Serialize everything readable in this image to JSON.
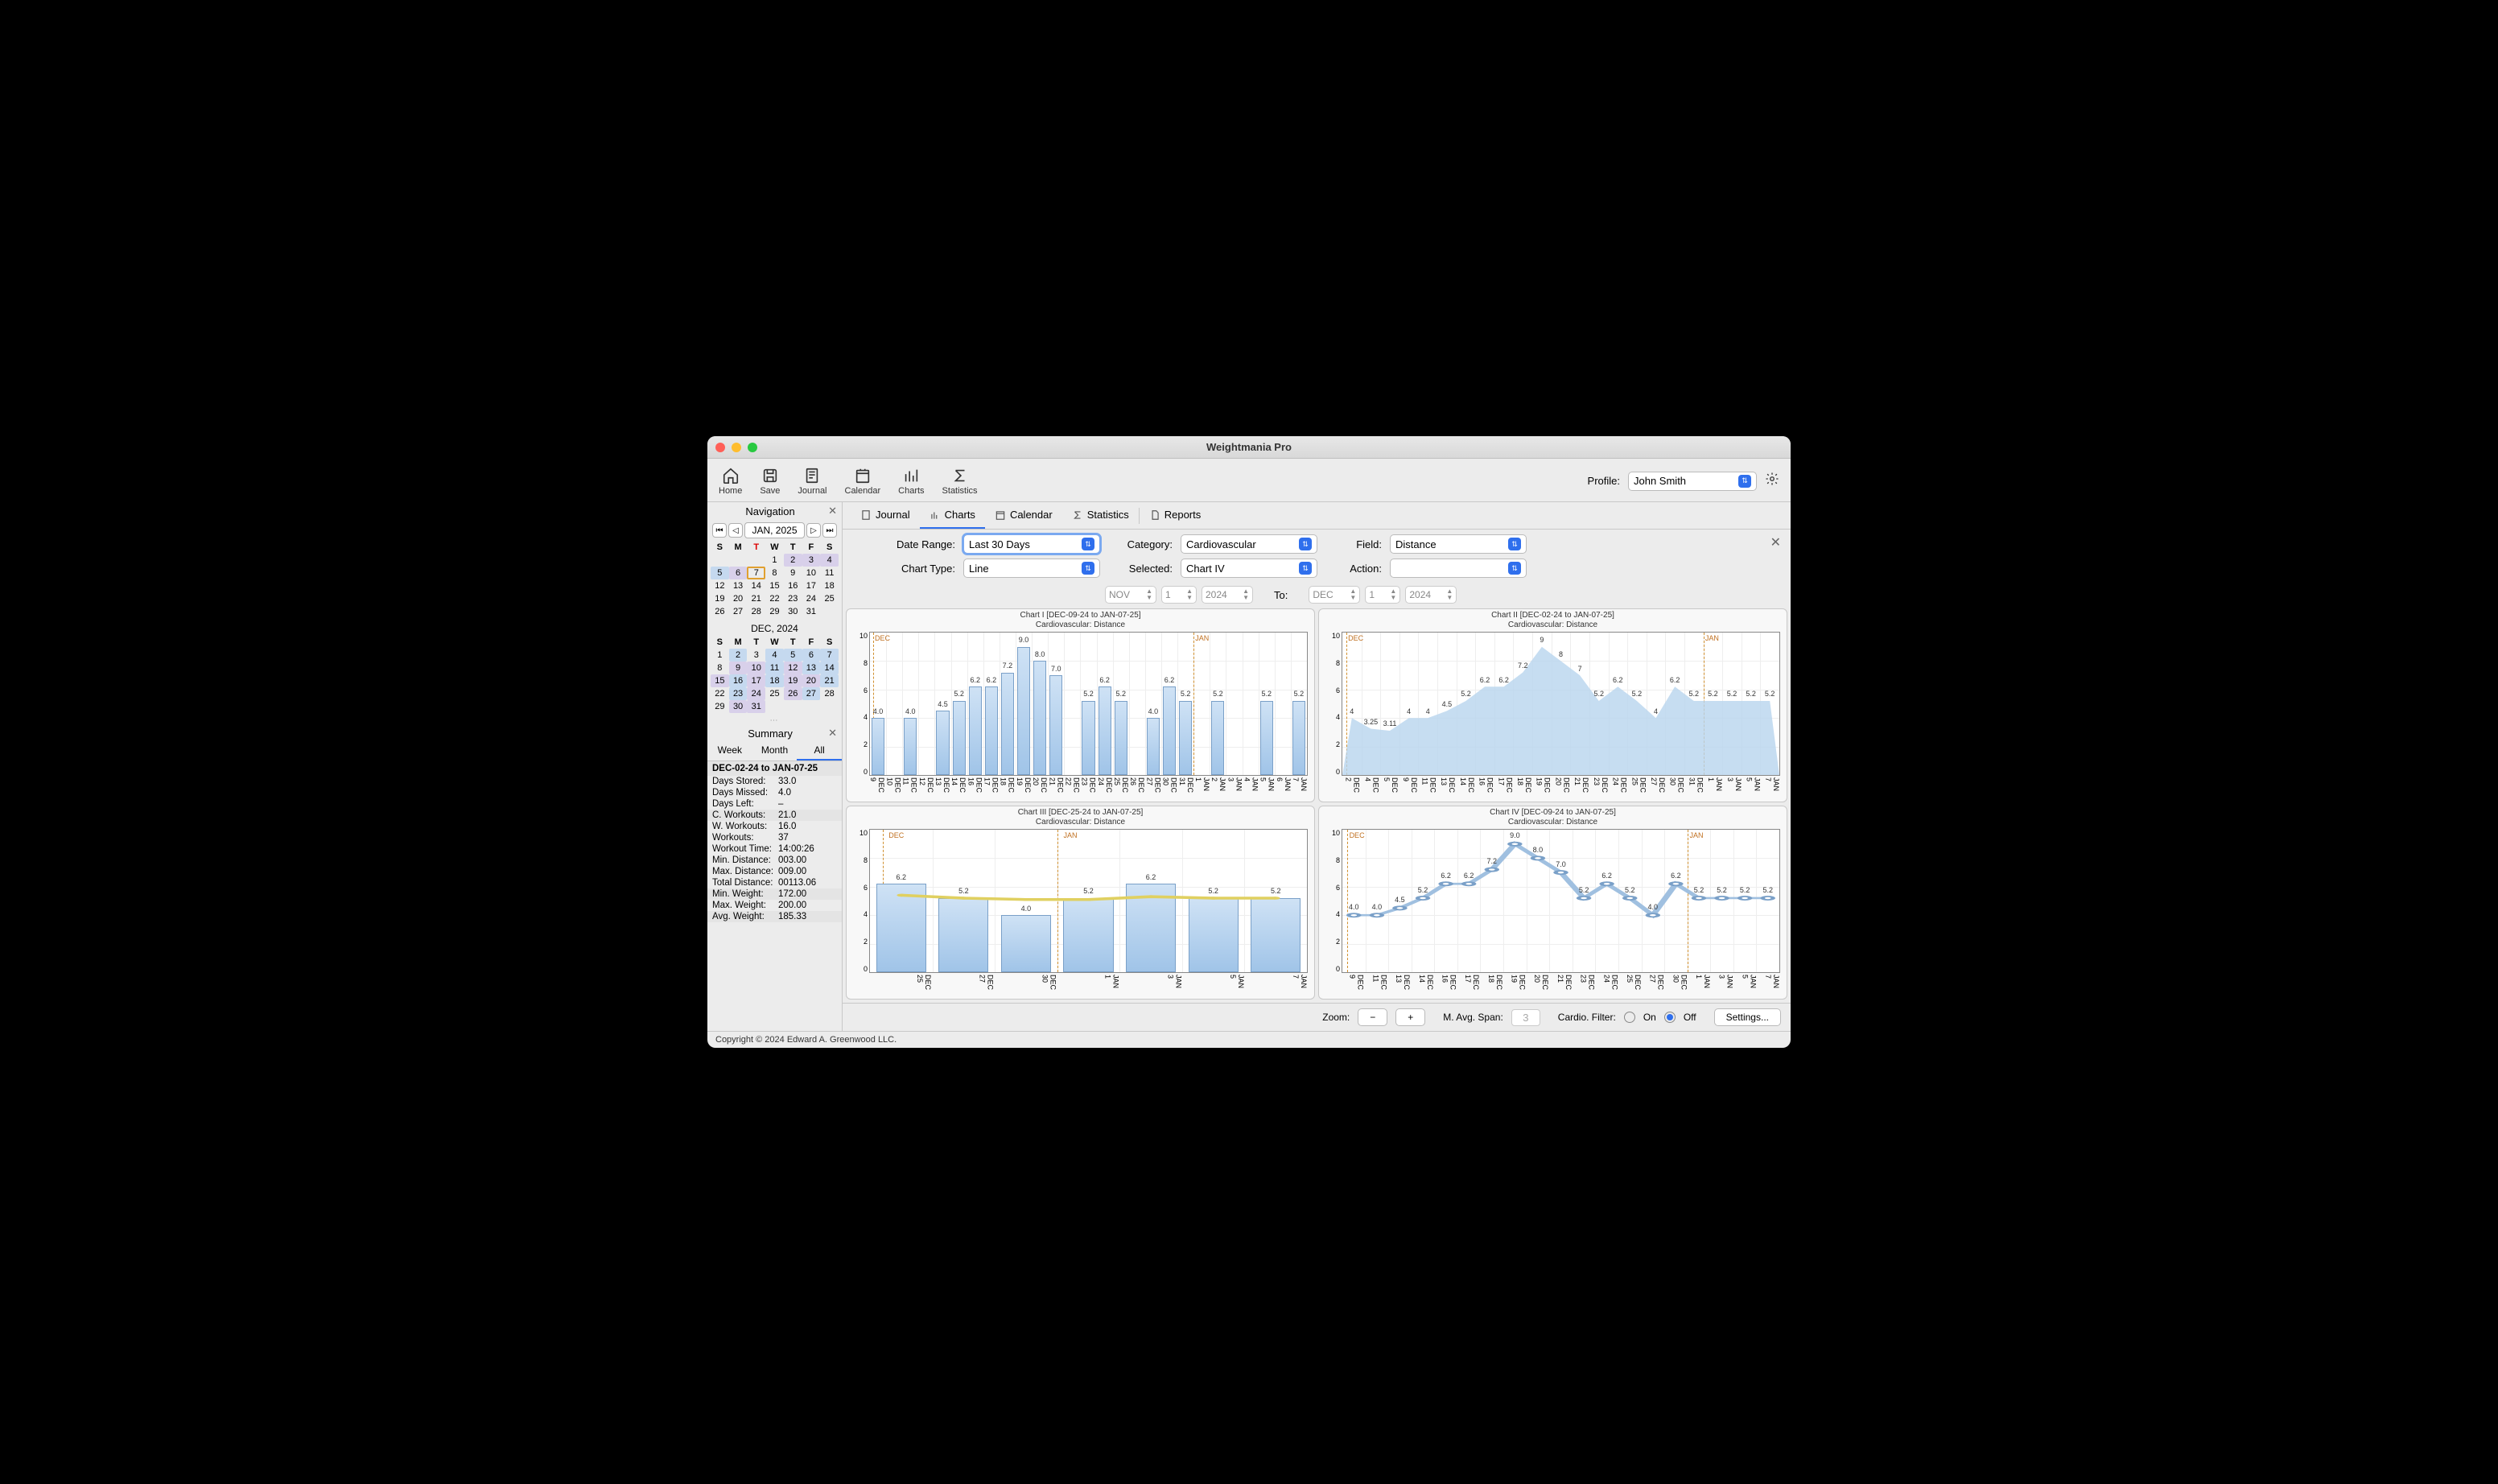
{
  "window_title": "Weightmania Pro",
  "toolbar": {
    "home": "Home",
    "save": "Save",
    "journal": "Journal",
    "calendar": "Calendar",
    "charts": "Charts",
    "statistics": "Statistics",
    "profile_label": "Profile:",
    "profile_value": "John Smith"
  },
  "tabs": {
    "journal": "Journal",
    "charts": "Charts",
    "calendar": "Calendar",
    "statistics": "Statistics",
    "reports": "Reports"
  },
  "filters": {
    "date_range_label": "Date Range:",
    "date_range": "Last 30 Days",
    "category_label": "Category:",
    "category": "Cardiovascular",
    "field_label": "Field:",
    "field": "Distance",
    "chart_type_label": "Chart Type:",
    "chart_type": "Line",
    "selected_label": "Selected:",
    "selected": "Chart IV",
    "action_label": "Action:",
    "action": "",
    "from_month": "NOV",
    "from_day": "1",
    "from_year": "2024",
    "to_label": "To:",
    "to_month": "DEC",
    "to_day": "1",
    "to_year": "2024"
  },
  "nav": {
    "title": "Navigation",
    "month_label": "JAN, 2025"
  },
  "calendars": {
    "weekdays": [
      "S",
      "M",
      "T",
      "W",
      "T",
      "F",
      "S"
    ],
    "jan": {
      "title": "",
      "today_col": 2,
      "start": 3,
      "days": 31,
      "highlight1": [
        2,
        3,
        4,
        6
      ],
      "highlight2": [
        5
      ],
      "selected": 7
    },
    "dec": {
      "title": "DEC, 2024",
      "start": 0,
      "days": 31,
      "highlight1": [
        9,
        10,
        12,
        15,
        17,
        19,
        20,
        24,
        26,
        30,
        31
      ],
      "highlight2": [
        2,
        4,
        5,
        6,
        7,
        11,
        13,
        14,
        16,
        18,
        21,
        23,
        27
      ]
    }
  },
  "summary": {
    "title": "Summary",
    "tabs": [
      "Week",
      "Month",
      "All"
    ],
    "active_tab": "All",
    "range": "DEC-02-24 to JAN-07-25",
    "rows": [
      {
        "k": "Days Stored:",
        "v": "33.0"
      },
      {
        "k": "Days Missed:",
        "v": "4.0"
      },
      {
        "k": "Days Left:",
        "v": "–"
      },
      {
        "k": "C. Workouts:",
        "v": "21.0",
        "alt": true
      },
      {
        "k": "W. Workouts:",
        "v": "16.0"
      },
      {
        "k": "Workouts:",
        "v": "37"
      },
      {
        "k": "Workout Time:",
        "v": "14:00:26"
      },
      {
        "k": "Min. Distance:",
        "v": "003.00"
      },
      {
        "k": "Max. Distance:",
        "v": "009.00"
      },
      {
        "k": "Total Distance:",
        "v": "00113.06"
      },
      {
        "k": "Min. Weight:",
        "v": "172.00",
        "alt": true
      },
      {
        "k": "Max. Weight:",
        "v": "200.00"
      },
      {
        "k": "Avg. Weight:",
        "v": "185.33",
        "alt": true
      }
    ]
  },
  "chart_data": [
    {
      "id": "chart1",
      "title": "Chart I [DEC-09-24 to JAN-07-25]",
      "subtitle": "Cardiovascular:  Distance",
      "type": "bar",
      "ylim": [
        0,
        10
      ],
      "month_markers": [
        "DEC",
        "JAN"
      ],
      "categories": [
        "DEC 9",
        "DEC 10",
        "DEC 11",
        "DEC 12",
        "DEC 13",
        "DEC 14",
        "DEC 16",
        "DEC 17",
        "DEC 18",
        "DEC 19",
        "DEC 20",
        "DEC 21",
        "DEC 22",
        "DEC 23",
        "DEC 24",
        "DEC 25",
        "DEC 26",
        "DEC 27",
        "DEC 30",
        "DEC 31",
        "JAN 1",
        "JAN 2",
        "JAN 3",
        "JAN 4",
        "JAN 5",
        "JAN 6",
        "JAN 7"
      ],
      "values": [
        4.0,
        null,
        4.0,
        null,
        4.5,
        5.2,
        6.2,
        6.2,
        7.2,
        9.0,
        8.0,
        7.0,
        null,
        5.2,
        6.2,
        5.2,
        null,
        4.0,
        6.2,
        5.2,
        null,
        5.2,
        null,
        null,
        5.2,
        null,
        5.2
      ]
    },
    {
      "id": "chart2",
      "title": "Chart II [DEC-02-24 to JAN-07-25]",
      "subtitle": "Cardiovascular:  Distance",
      "type": "area",
      "ylim": [
        0,
        10
      ],
      "month_markers": [
        "DEC",
        "JAN"
      ],
      "categories": [
        "DEC 2",
        "DEC 4",
        "DEC 5",
        "DEC 9",
        "DEC 11",
        "DEC 13",
        "DEC 14",
        "DEC 16",
        "DEC 17",
        "DEC 18",
        "DEC 19",
        "DEC 20",
        "DEC 21",
        "DEC 23",
        "DEC 24",
        "DEC 25",
        "DEC 27",
        "DEC 30",
        "DEC 31",
        "JAN 1",
        "JAN 3",
        "JAN 5",
        "JAN 7"
      ],
      "values": [
        4.0,
        3.25,
        3.11,
        4.0,
        4.0,
        4.5,
        5.2,
        6.2,
        6.2,
        7.2,
        9.0,
        8.0,
        7.0,
        5.2,
        6.2,
        5.2,
        4.0,
        6.2,
        5.2,
        5.2,
        5.2,
        5.2,
        5.2
      ]
    },
    {
      "id": "chart3",
      "title": "Chart III [DEC-25-24 to JAN-07-25]",
      "subtitle": "Cardiovascular:  Distance",
      "type": "bar_with_avg",
      "ylim": [
        0,
        10
      ],
      "month_markers": [
        "DEC",
        "JAN"
      ],
      "categories": [
        "DEC 25",
        "DEC 27",
        "DEC 30",
        "JAN 1",
        "JAN 3",
        "JAN 5",
        "JAN 7"
      ],
      "values": [
        6.2,
        5.2,
        4.0,
        5.2,
        6.2,
        5.2,
        5.2
      ],
      "avg": [
        5.4,
        5.2,
        5.1,
        5.1,
        5.3,
        5.2,
        5.2
      ]
    },
    {
      "id": "chart4",
      "title": "Chart IV [DEC-09-24 to JAN-07-25]",
      "subtitle": "Cardiovascular:  Distance",
      "type": "line",
      "ylim": [
        0,
        10
      ],
      "month_markers": [
        "DEC",
        "JAN"
      ],
      "categories": [
        "DEC 9",
        "DEC 11",
        "DEC 13",
        "DEC 14",
        "DEC 16",
        "DEC 17",
        "DEC 18",
        "DEC 19",
        "DEC 20",
        "DEC 21",
        "DEC 23",
        "DEC 24",
        "DEC 25",
        "DEC 27",
        "DEC 30",
        "JAN 1",
        "JAN 3",
        "JAN 5",
        "JAN 7"
      ],
      "values": [
        4.0,
        4.0,
        4.5,
        5.2,
        6.2,
        6.2,
        7.2,
        9.0,
        8.0,
        7.0,
        5.2,
        6.2,
        5.2,
        4.0,
        6.2,
        5.2,
        5.2,
        5.2,
        5.2
      ]
    }
  ],
  "bottom": {
    "zoom_label": "Zoom:",
    "minus": "−",
    "plus": "+",
    "mavg_label": "M. Avg. Span:",
    "mavg_value": "3",
    "cardio_filter_label": "Cardio. Filter:",
    "on": "On",
    "off": "Off",
    "settings": "Settings..."
  },
  "footer": "Copyright © 2024 Edward A. Greenwood LLC."
}
